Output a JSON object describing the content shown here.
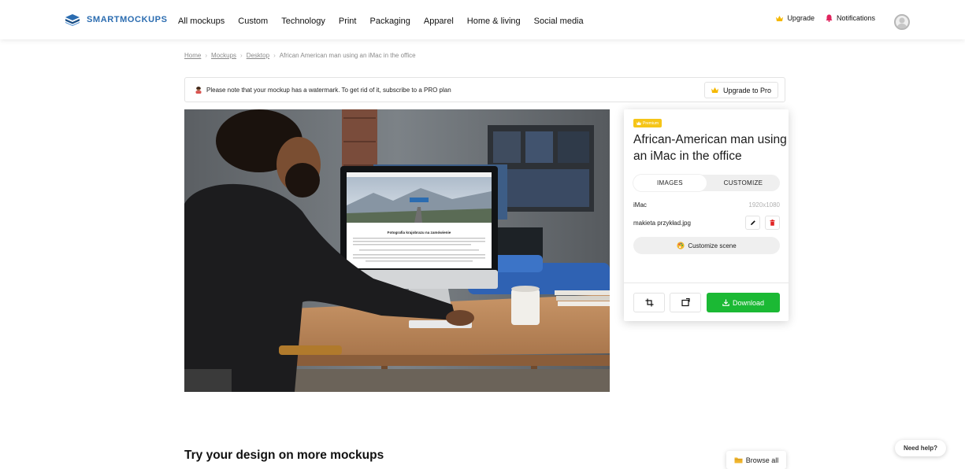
{
  "brand": {
    "name": "SMARTMOCKUPS",
    "color": "#2b6cb0"
  },
  "nav": {
    "items": [
      "All mockups",
      "Custom",
      "Technology",
      "Print",
      "Packaging",
      "Apparel",
      "Home & living",
      "Social media"
    ]
  },
  "user_nav": {
    "upgrade": "Upgrade",
    "notifications": "Notifications",
    "icons": [
      "crown-icon",
      "bell-icon",
      "avatar"
    ]
  },
  "breadcrumb": {
    "items": [
      "Home",
      "Mockups",
      "Desktop",
      "African American man using an iMac in the office"
    ]
  },
  "notice": {
    "text": "Please note that your mockup has a watermark. To get rid of it, subscribe to a PRO plan",
    "button": "Upgrade to Pro"
  },
  "mockup_preview": {
    "screen_heading": "Fotografia krajobrazu na zamówienie"
  },
  "panel": {
    "badge": "Premium",
    "title": "African-American man using an iMac in the office",
    "tabs": [
      "IMAGES",
      "CUSTOMIZE"
    ],
    "active_tab": "IMAGES",
    "device": "iMac",
    "resolution": "1920x1080",
    "file_name": "makieta przykład.jpg",
    "customize_scene": "Customize scene",
    "download": "Download"
  },
  "bottom": {
    "heading": "Try your design on more mockups",
    "browse_all": "Browse all",
    "need_help": "Need help?"
  },
  "colors": {
    "accent_green": "#1bb934",
    "premium_yellow": "#f5c518",
    "delete_red": "#e02424",
    "light_gray": "#efefef"
  }
}
